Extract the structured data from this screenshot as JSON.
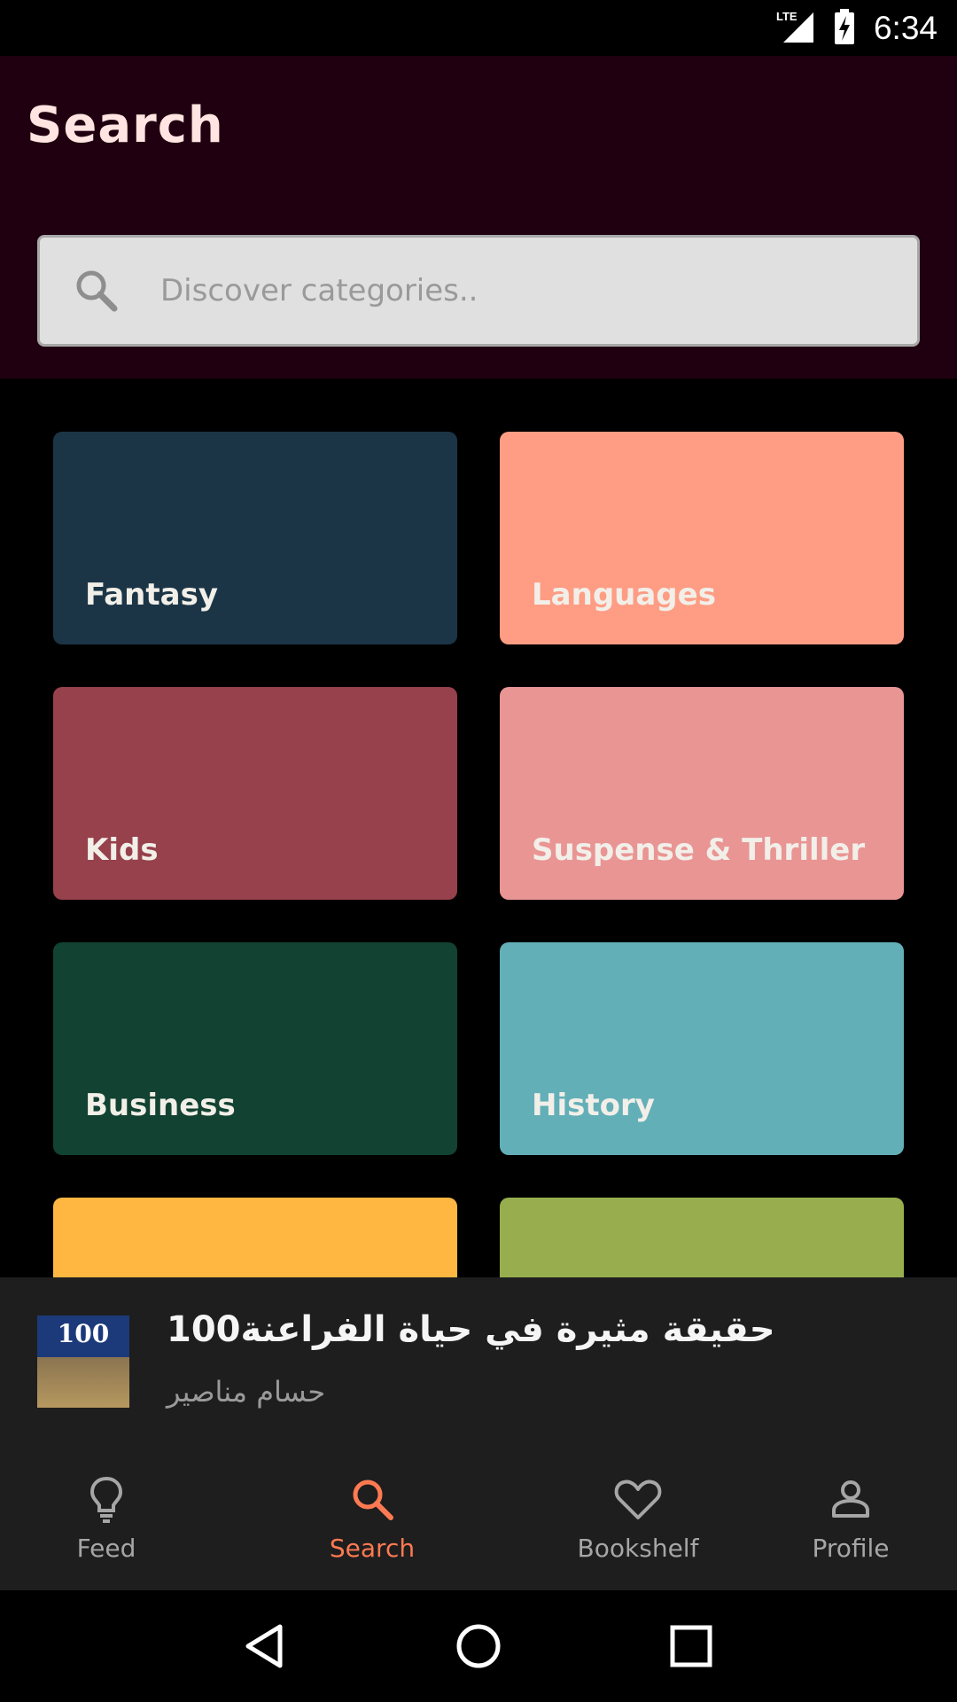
{
  "status_bar": {
    "network": "LTE",
    "time": "6:34"
  },
  "header": {
    "title": "Search"
  },
  "search": {
    "placeholder": "Discover categories.."
  },
  "categories": [
    {
      "label": "Fantasy",
      "color": "#1b3546"
    },
    {
      "label": "Languages",
      "color": "#fe9d84"
    },
    {
      "label": "Kids",
      "color": "#96414b"
    },
    {
      "label": "Suspense & Thriller",
      "color": "#e99594"
    },
    {
      "label": "Business",
      "color": "#124232"
    },
    {
      "label": "History",
      "color": "#63afb7"
    },
    {
      "label": "",
      "color": "#ffb742"
    },
    {
      "label": "",
      "color": "#98ae4e"
    }
  ],
  "mini_player": {
    "title": "100حقيقة مثيرة في حياة الفراعنة",
    "author": "حسام مناصير",
    "cover_text": "100"
  },
  "bottom_nav": {
    "items": [
      {
        "label": "Feed",
        "icon": "lightbulb-icon"
      },
      {
        "label": "Search",
        "icon": "search-icon",
        "active": true
      },
      {
        "label": "Bookshelf",
        "icon": "heart-icon"
      },
      {
        "label": "Profile",
        "icon": "person-icon"
      }
    ]
  },
  "colors": {
    "accent": "#ff7a52",
    "header_bg": "#200010",
    "nav_bg": "#1e1e1e"
  }
}
